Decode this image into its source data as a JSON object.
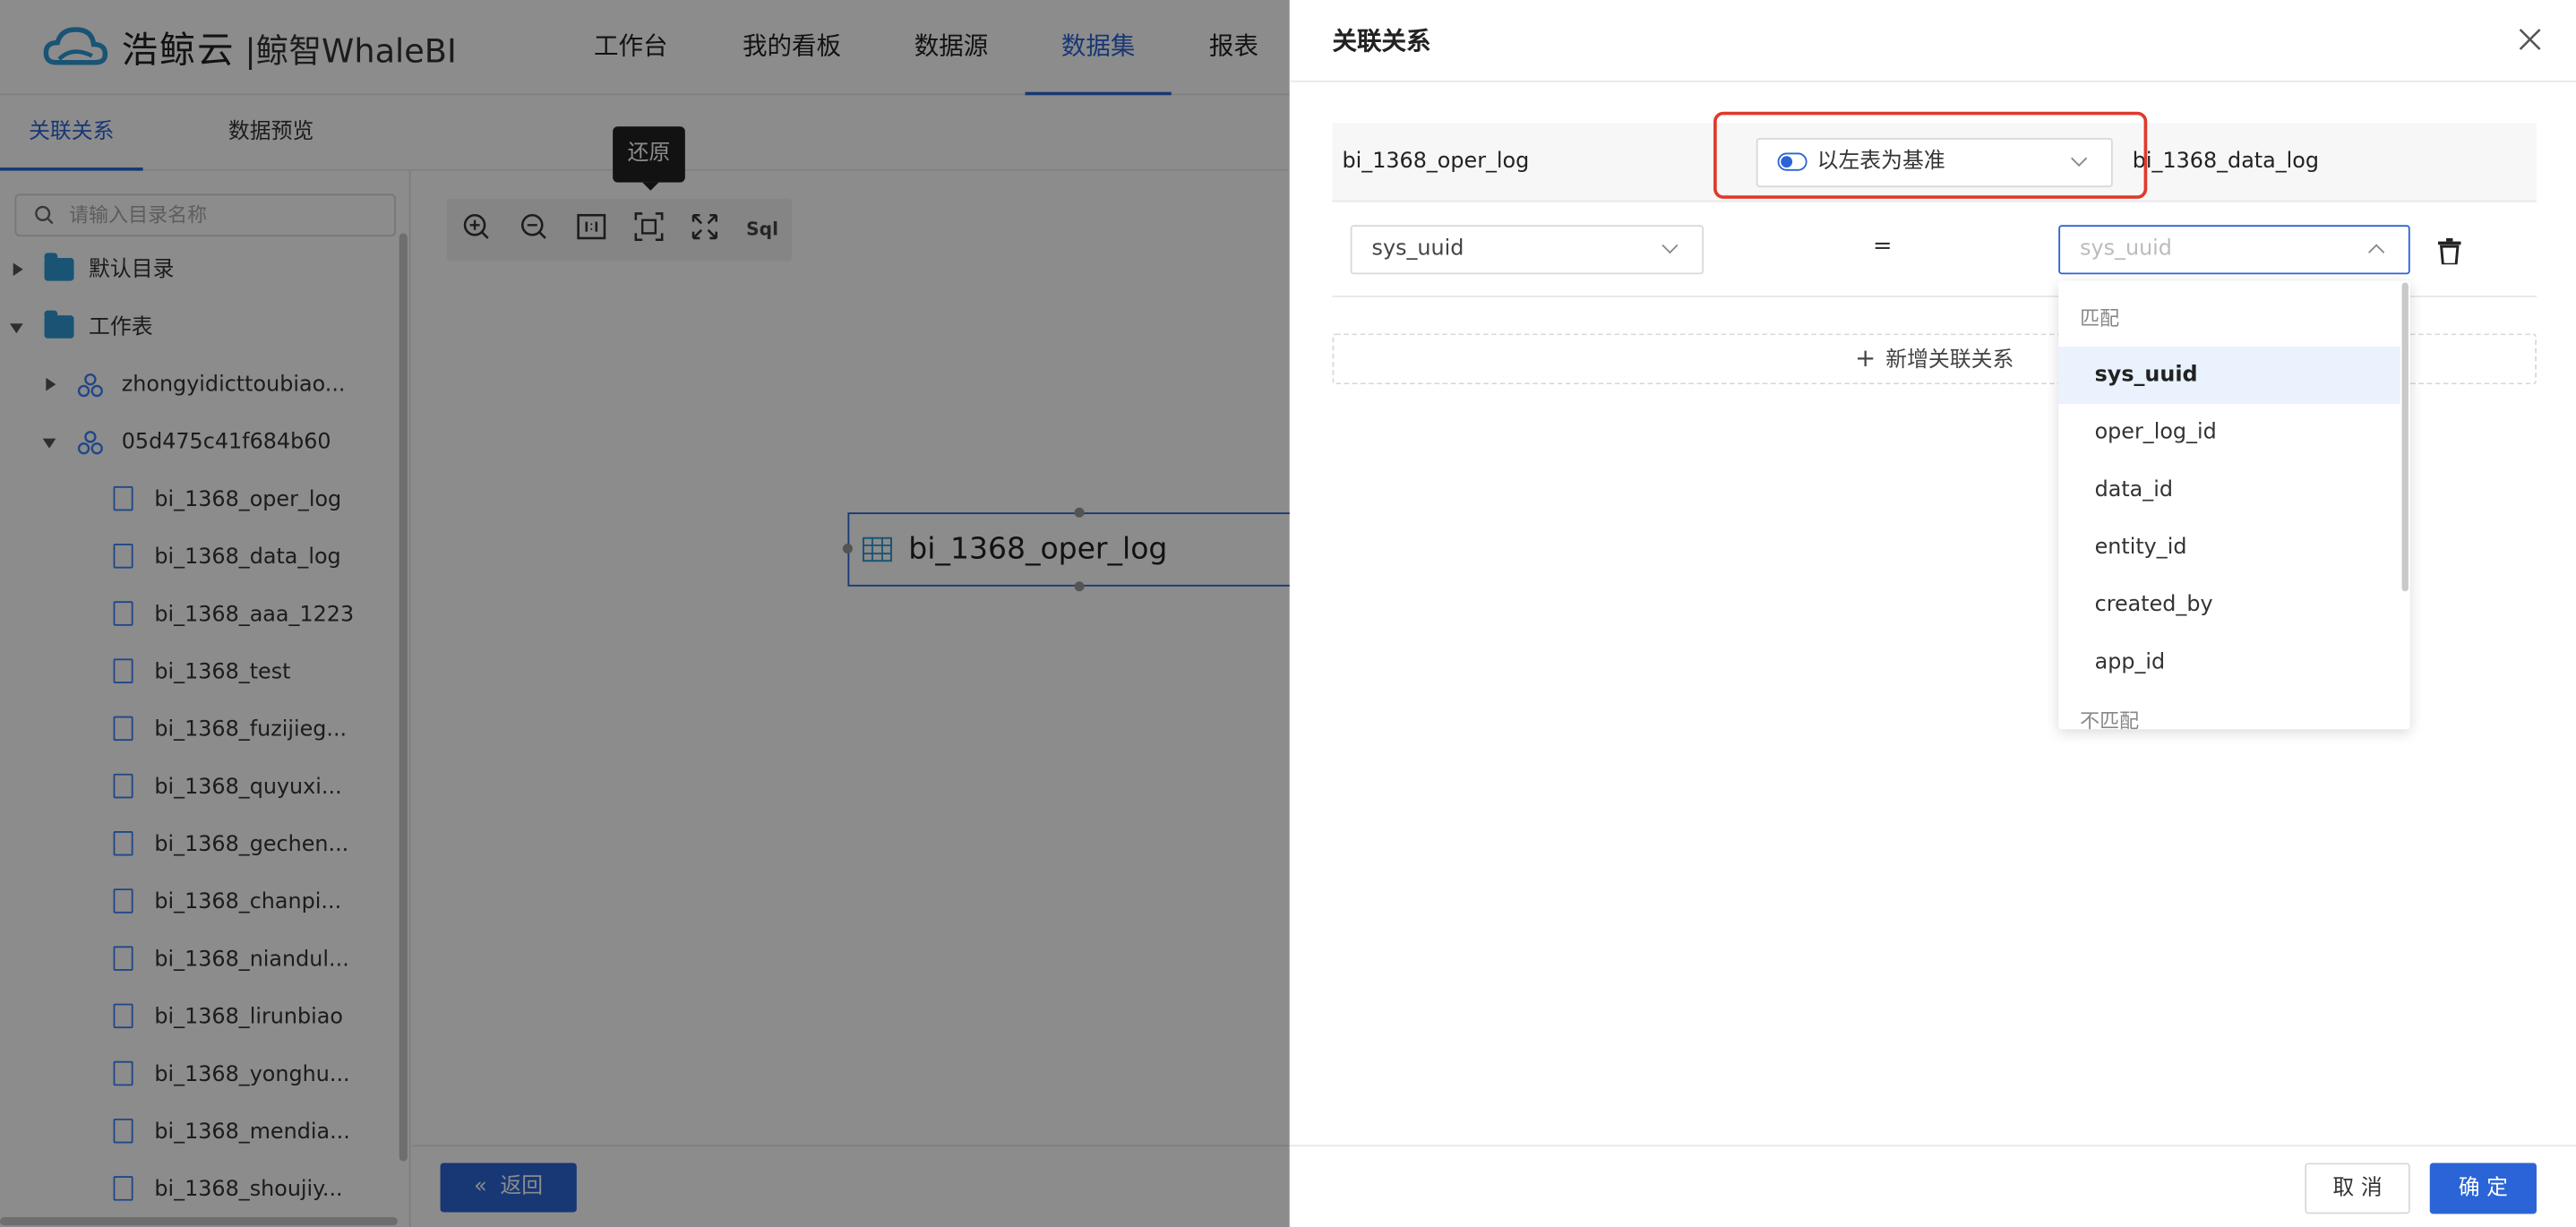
{
  "brand": {
    "logo_text": "浩鲸云",
    "product": "|鲸智WhaleBI"
  },
  "nav": {
    "items": [
      "工作台",
      "我的看板",
      "数据源",
      "数据集",
      "报表"
    ],
    "active": "数据集"
  },
  "subtabs": {
    "items": [
      "关联关系",
      "数据预览"
    ],
    "active": "关联关系"
  },
  "sidebar": {
    "search_placeholder": "请输入目录名称",
    "folders": [
      "默认目录",
      "工作表"
    ],
    "groups": [
      "zhongyidicttoubiao...",
      "05d475c41f684b60"
    ],
    "files": [
      "bi_1368_oper_log",
      "bi_1368_data_log",
      "bi_1368_aaa_1223",
      "bi_1368_test",
      "bi_1368_fuzijieg...",
      "bi_1368_quyuxi...",
      "bi_1368_gechen...",
      "bi_1368_chanpi...",
      "bi_1368_niandul...",
      "bi_1368_lirunbiao",
      "bi_1368_yonghu...",
      "bi_1368_mendia...",
      "bi_1368_shoujiy..."
    ]
  },
  "toolbar": {
    "tooltip": "还原",
    "sql_label": "Sql"
  },
  "canvas": {
    "node_label": "bi_1368_oper_log",
    "back_label": "返回"
  },
  "drawer": {
    "title": "关联关系",
    "left_table": "bi_1368_oper_log",
    "right_table": "bi_1368_data_log",
    "join_type": "以左表为基准",
    "left_field": "sys_uuid",
    "equals": "=",
    "right_field_placeholder": "sys_uuid",
    "add_label": "新增关联关系",
    "dropdown": {
      "group_match": "匹配",
      "group_nomatch": "不匹配",
      "items": [
        "sys_uuid",
        "oper_log_id",
        "data_id",
        "entity_id",
        "created_by",
        "app_id"
      ],
      "selected": "sys_uuid"
    },
    "cancel_label": "取 消",
    "ok_label": "确 定"
  },
  "colors": {
    "accent": "#2a64d6",
    "highlight": "#e03a2a",
    "folder": "#2f9ad6"
  }
}
